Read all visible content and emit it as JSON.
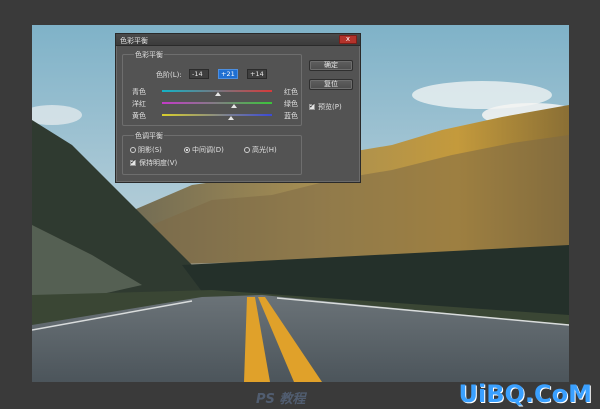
{
  "dialog": {
    "title": "色彩平衡",
    "close_label": "x",
    "color_balance_group": "色彩平衡",
    "levels_label": "色阶(L):",
    "levels": [
      "-14",
      "+21",
      "+14"
    ],
    "sliders": [
      {
        "left": "青色",
        "right": "红色",
        "value": -14,
        "gradient": [
          "#12b3c7",
          "#d73a3a"
        ]
      },
      {
        "left": "洋红",
        "right": "绿色",
        "value": 21,
        "gradient": [
          "#c43ac8",
          "#3bc43b"
        ]
      },
      {
        "left": "黄色",
        "right": "蓝色",
        "value": 14,
        "gradient": [
          "#d9cf2c",
          "#3b4ad6"
        ]
      }
    ],
    "tone_group": "色调平衡",
    "tones": [
      {
        "label": "阴影(S)",
        "selected": false
      },
      {
        "label": "中间调(D)",
        "selected": true
      },
      {
        "label": "高光(H)",
        "selected": false
      }
    ],
    "preserve_luminosity": "保持明度(V)",
    "ok_label": "确定",
    "reset_label": "复位",
    "preview_label": "预览(P)"
  },
  "watermark": {
    "text": "UiBQ.CoM",
    "small": "PS 教程"
  }
}
